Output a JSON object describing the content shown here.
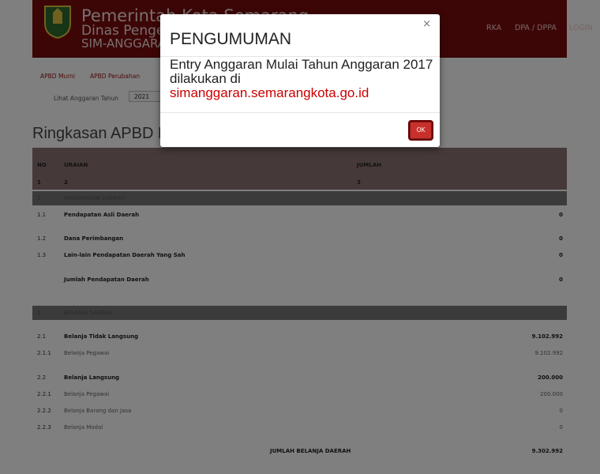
{
  "header": {
    "line1": "Pemerintah Kota Semarang",
    "line2": "Dinas Pengelolaan Keuangan",
    "line3": "SIM-ANGGARAN",
    "nav": [
      "RKA",
      "DPA / DPPA",
      "LOGIN"
    ]
  },
  "tabs": [
    "APBD Murni",
    "APBD Perubahan"
  ],
  "year_filter": {
    "label": "Lihat Anggaran Tahun",
    "value": "2021"
  },
  "page_title": "Ringkasan APBD Murni",
  "table": {
    "headers": [
      "NO",
      "URAIAN",
      "JUMLAH"
    ],
    "numbering": [
      "1",
      "2",
      "3"
    ],
    "rows": [
      {
        "no": "1",
        "uraian": "PENDAPATAN DAERAH",
        "jumlah": "",
        "kind": "section"
      },
      {
        "no": "1.1",
        "uraian": "Pendapatan Asli Daerah",
        "jumlah": "0",
        "kind": "bold"
      },
      {
        "no": "1.2",
        "uraian": "Dana Perimbangan",
        "jumlah": "0",
        "kind": "bold"
      },
      {
        "no": "1.3",
        "uraian": "Lain-lain Pendapatan Daerah Yang Sah",
        "jumlah": "0",
        "kind": "bold"
      },
      {
        "no": "",
        "uraian": "Jumlah Pendapatan Daerah",
        "jumlah": "0",
        "kind": "bold"
      },
      {
        "no": "2",
        "uraian": "BELANJA DAERAH",
        "jumlah": "",
        "kind": "section"
      },
      {
        "no": "2.1",
        "uraian": "Belanja Tidak Langsung",
        "jumlah": "9.102.992",
        "kind": "bold"
      },
      {
        "no": "2.1.1",
        "uraian": "Belanja Pegawai",
        "jumlah": "9.102.992",
        "kind": "light"
      },
      {
        "no": "2.2",
        "uraian": "Belanja Langsung",
        "jumlah": "200.000",
        "kind": "bold"
      },
      {
        "no": "2.2.1",
        "uraian": "Belanja Pegawai",
        "jumlah": "200.000",
        "kind": "light"
      },
      {
        "no": "2.2.2",
        "uraian": "Belanja Barang dan Jasa",
        "jumlah": "0",
        "kind": "light"
      },
      {
        "no": "2.2.3",
        "uraian": "Belanja Modal",
        "jumlah": "0",
        "kind": "light"
      },
      {
        "no": "",
        "uraian": "JUMLAH BELANJA DAERAH",
        "jumlah": "9.302.992",
        "kind": "bold"
      }
    ]
  },
  "modal": {
    "title": "PENGUMUMAN",
    "close": "×",
    "body": "Entry Anggaran Mulai Tahun Anggaran 2017 dilakukan di",
    "link": "simanggaran.semarangkota.go.id",
    "ok": "OK"
  },
  "colors": {
    "header": "#7a0c0c",
    "accent": "#c9302c",
    "link": "#cc0000"
  }
}
